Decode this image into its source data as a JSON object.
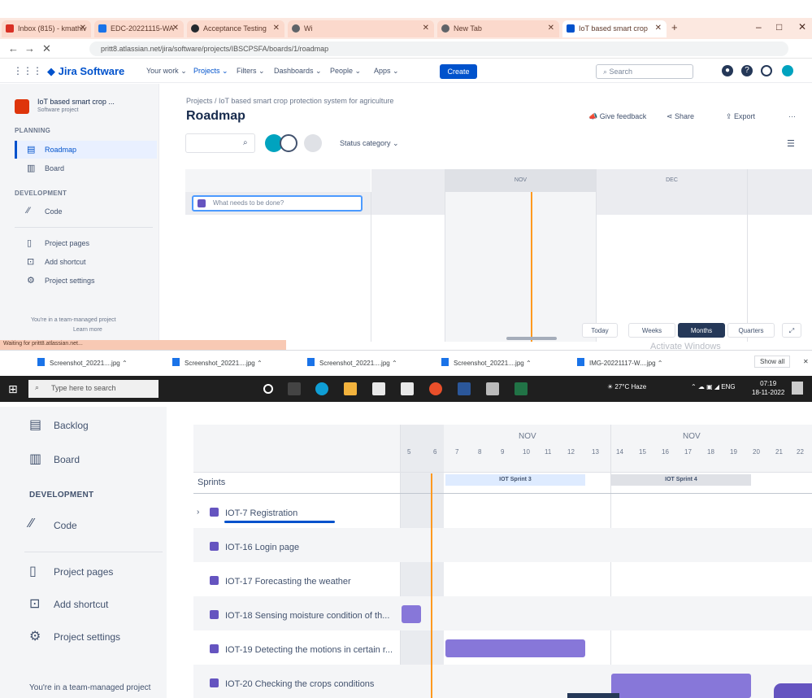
{
  "browser": {
    "tabs": [
      {
        "label": "Inbox (815) - kmathiv",
        "color": "#d93025"
      },
      {
        "label": "EDC-20221115-WA",
        "color": "#1a73e8"
      },
      {
        "label": "Acceptance Testing",
        "color": "#24292e"
      },
      {
        "label": "Wi",
        "color": "#5f6368"
      },
      {
        "label": "New Tab",
        "color": "#5f6368"
      },
      {
        "label": "IoT based smart crop",
        "color": "#0052cc"
      }
    ],
    "url": "pritt8.atlassian.net/jira/software/projects/IBSCPSFA/boards/1/roadmap",
    "window_controls": [
      "–",
      "□",
      "✕"
    ]
  },
  "jira": {
    "logo": "Jira Software",
    "nav": [
      "Your work ⌄",
      "Projects ⌄",
      "Filters ⌄",
      "Dashboards ⌄",
      "People ⌄",
      "Apps ⌄"
    ],
    "create": "Create",
    "search_placeholder": "Search"
  },
  "sidebar": {
    "project_name": "IoT based smart crop ...",
    "project_type": "Software project",
    "planning": "PLANNING",
    "roadmap": "Roadmap",
    "board": "Board",
    "development": "DEVELOPMENT",
    "code": "Code",
    "project_pages": "Project pages",
    "add_shortcut": "Add shortcut",
    "project_settings": "Project settings",
    "team_managed": "You're in a team-managed project",
    "learn_more": "Learn more"
  },
  "roadmap": {
    "breadcrumb": "Projects / IoT based smart crop protection system for agriculture",
    "title": "Roadmap",
    "give_feedback": "Give feedback",
    "share": "Share",
    "export": "Export",
    "more": "···",
    "status_category": "Status category ⌄",
    "months": [
      "",
      "NOV",
      "DEC"
    ],
    "what_needs": "What needs to be done?",
    "zoom": [
      "Today",
      "Weeks",
      "Months",
      "Quarters"
    ],
    "status_text": "Waiting for pritt8.atlassian.net...",
    "watermark": "Activate Windows"
  },
  "downloads": [
    "Screenshot_20221....jpg",
    "Screenshot_20221....jpg",
    "Screenshot_20221....jpg",
    "Screenshot_20221....jpg",
    "IMG-20221117-W....jpg"
  ],
  "show_all": "Show all",
  "taskbar": {
    "search": "Type here to search",
    "weather": "27°C Haze",
    "time": "07:19",
    "date": "18-11-2022"
  },
  "bottom": {
    "backlog": "Backlog",
    "board": "Board",
    "development": "DEVELOPMENT",
    "code": "Code",
    "project_pages": "Project pages",
    "add_shortcut": "Add shortcut",
    "project_settings": "Project settings",
    "team_managed": "You're in a team-managed project",
    "months": [
      "NOV",
      "NOV"
    ],
    "days": [
      "5",
      "6",
      "7",
      "8",
      "9",
      "10",
      "11",
      "12",
      "13",
      "14",
      "15",
      "16",
      "17",
      "18",
      "19",
      "20",
      "21",
      "22"
    ],
    "sprints_label": "Sprints",
    "sprint3": "IOT Sprint 3",
    "sprint4": "IOT Sprint 4",
    "rows": [
      "IOT-7 Registration",
      "IOT-16 Login page",
      "IOT-17 Forecasting the weather",
      "IOT-18 Sensing moisture condition of th...",
      "IOT-19 Detecting the motions in certain r...",
      "IOT-20 Checking the crops conditions"
    ]
  }
}
